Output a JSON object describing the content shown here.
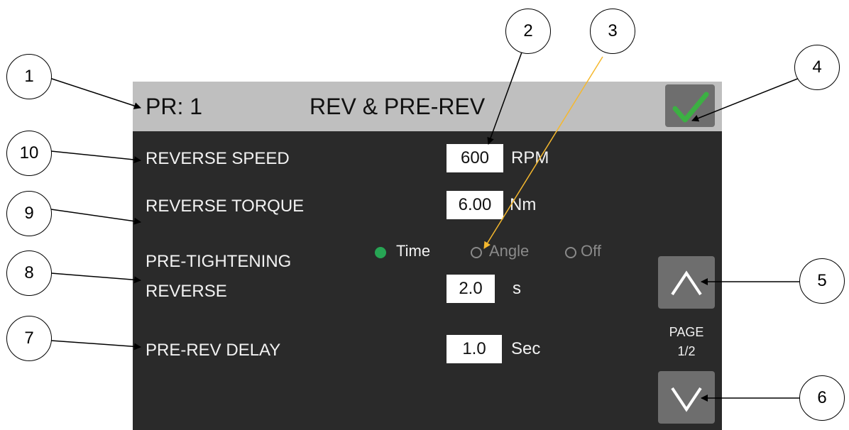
{
  "header": {
    "pr_label": "PR: 1",
    "title": "REV & PRE-REV",
    "confirm_icon": "checkmark-icon"
  },
  "fields": {
    "reverse_speed": {
      "label": "REVERSE SPEED",
      "value": "600",
      "unit": "RPM"
    },
    "reverse_torque": {
      "label": "REVERSE TORQUE",
      "value": "6.00",
      "unit": "Nm"
    },
    "pre_tightening_reverse": {
      "label_line1": "PRE-TIGHTENING",
      "label_line2": "REVERSE",
      "value": "2.0",
      "unit": "s",
      "options": [
        {
          "label": "Time",
          "selected": true
        },
        {
          "label": "Angle",
          "selected": false
        },
        {
          "label": "Off",
          "selected": false
        }
      ]
    },
    "pre_rev_delay": {
      "label": "PRE-REV DELAY",
      "value": "1.0",
      "unit": "Sec"
    }
  },
  "paging": {
    "line1": "PAGE",
    "line2": "1/2",
    "up_icon": "chevron-up-icon",
    "down_icon": "chevron-down-icon"
  },
  "callouts": [
    "1",
    "2",
    "3",
    "4",
    "5",
    "6",
    "7",
    "8",
    "9",
    "10"
  ],
  "colors": {
    "header_bg": "#bfbfbf",
    "screen_bg": "#2a2a2a",
    "button_bg": "#6e6e6e",
    "check_green": "#3cb043",
    "radio_selected": "#27a554",
    "radio_disabled": "#8a8a8a",
    "callout_arrow_highlight": "#f5b82e"
  }
}
